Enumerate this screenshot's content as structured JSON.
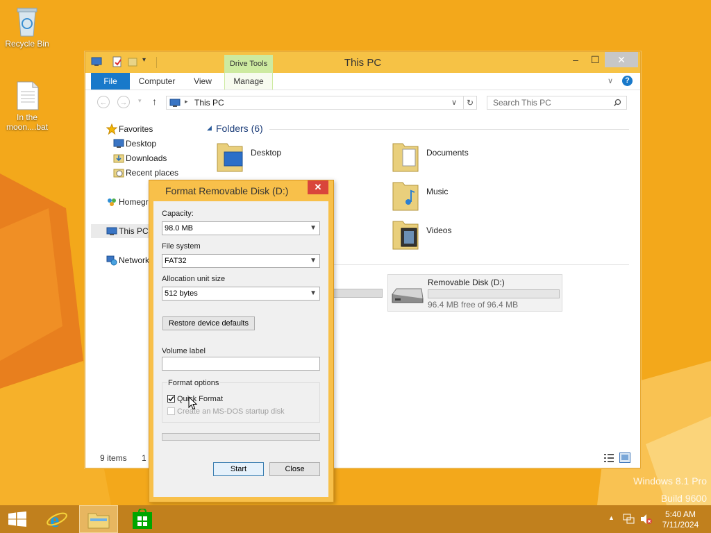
{
  "desktop": {
    "icons": [
      {
        "label": "Recycle Bin"
      },
      {
        "label": "In the moon....bat"
      }
    ],
    "watermark": {
      "line1": "Windows 8.1 Pro",
      "line2": "Build 9600"
    }
  },
  "explorer": {
    "title": "This PC",
    "contextual_tab_group": "Drive Tools",
    "ribbon_tabs": [
      "File",
      "Computer",
      "View",
      "Manage"
    ],
    "address": "This PC",
    "search_placeholder": "Search This PC",
    "nav_pane": {
      "favorites": "Favorites",
      "favorite_items": [
        "Desktop",
        "Downloads",
        "Recent places"
      ],
      "homegroup": "Homegr",
      "this_pc": "This PC",
      "network": "Network"
    },
    "folders_header": "Folders (6)",
    "folders": [
      "Desktop",
      "Documents",
      "Music",
      "Videos"
    ],
    "removable_disk": {
      "name": "Removable Disk (D:)",
      "free_text": "96.4 MB free of 96.4 MB",
      "used_fraction": 0.0
    },
    "status": {
      "items": "9 items",
      "selected": "1"
    }
  },
  "dialog": {
    "title": "Format Removable Disk (D:)",
    "capacity_label": "Capacity:",
    "capacity_value": "98.0 MB",
    "filesystem_label": "File system",
    "filesystem_value": "FAT32",
    "alloc_label": "Allocation unit size",
    "alloc_value": "512 bytes",
    "restore_button": "Restore device defaults",
    "volume_label": "Volume label",
    "volume_value": "",
    "format_options_label": "Format options",
    "quick_format_label": "Quick Format",
    "quick_format_checked": true,
    "msdos_label": "Create an MS-DOS startup disk",
    "msdos_checked": false,
    "progress_fraction": 0.0,
    "start_button": "Start",
    "close_button": "Close"
  },
  "taskbar": {
    "time": "5:40 AM",
    "date": "7/11/2024"
  },
  "colors": {
    "desktop": "#f3a81b",
    "titlebar": "#f6c245",
    "file_tab": "#1979ca",
    "drive_tools": "#cdeaa0",
    "dialog_frame": "#f8c04a",
    "close_red": "#d9453b"
  }
}
